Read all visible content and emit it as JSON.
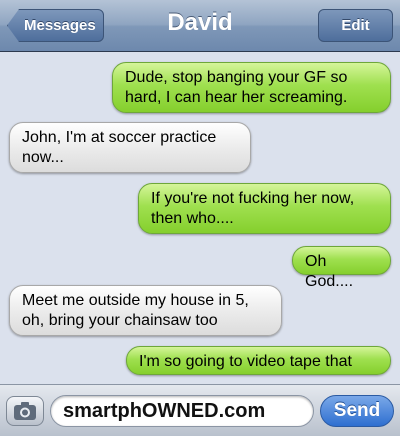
{
  "header": {
    "back_label": "Messages",
    "title": "David",
    "edit_label": "Edit"
  },
  "messages": [
    {
      "direction": "sent",
      "text": "Dude, stop banging your GF so hard, I can hear her screaming."
    },
    {
      "direction": "received",
      "text": "John, I'm at soccer practice now..."
    },
    {
      "direction": "sent",
      "text": "If you're not fucking her now, then who...."
    },
    {
      "direction": "sent",
      "text": "Oh God...."
    },
    {
      "direction": "received",
      "text": "Meet me outside my house in 5, oh, bring your chainsaw too"
    },
    {
      "direction": "sent",
      "text": "I'm so going to video tape that"
    }
  ],
  "composer": {
    "input_value": "smartphOWNED.com",
    "send_label": "Send",
    "camera_icon": "camera-icon"
  },
  "colors": {
    "sent_bubble": "#9fe04f",
    "received_bubble": "#ececec",
    "background": "#dbe1ed",
    "send_button": "#2e6fd0"
  }
}
